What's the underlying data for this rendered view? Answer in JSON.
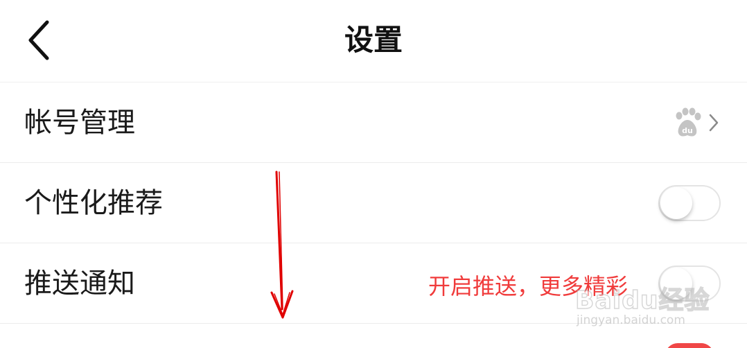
{
  "header": {
    "title": "设置"
  },
  "settings": {
    "items": [
      {
        "label": "帐号管理",
        "accessory": "baidu-paw-chevron"
      },
      {
        "label": "个性化推荐",
        "accessory": "toggle",
        "enabled": false
      },
      {
        "label": "推送通知",
        "accessory": "toggle",
        "enabled": false,
        "hint": "开启推送，更多精彩"
      }
    ]
  },
  "watermark": {
    "brand": "Baidu经验",
    "domain": "jingyan.baidu.com"
  },
  "colors": {
    "hint_text": "#f03b3b",
    "annotation_arrow": "#e00000",
    "accent_toggle": "#f04747"
  },
  "icons": {
    "back": "chevron-left-icon",
    "account": "baidu-paw-icon",
    "chevron": "chevron-right-icon"
  }
}
